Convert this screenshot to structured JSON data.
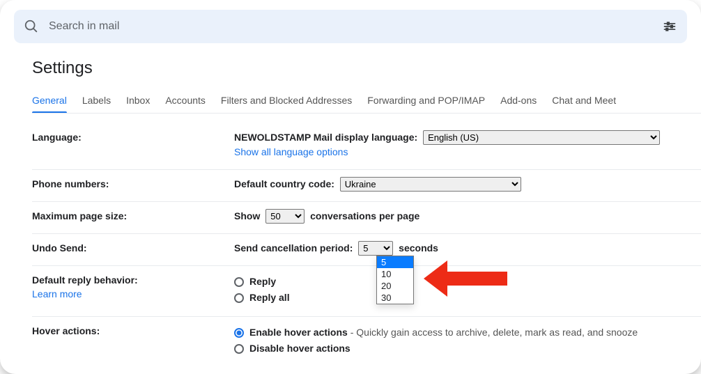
{
  "search": {
    "placeholder": "Search in mail"
  },
  "page_title": "Settings",
  "tabs": [
    "General",
    "Labels",
    "Inbox",
    "Accounts",
    "Filters and Blocked Addresses",
    "Forwarding and POP/IMAP",
    "Add-ons",
    "Chat and Meet"
  ],
  "language": {
    "label": "Language:",
    "display_language_label": "NEWOLDSTAMP Mail display language:",
    "selected": "English (US)",
    "show_all": "Show all language options"
  },
  "phone": {
    "label": "Phone numbers:",
    "default_country_label": "Default country code:",
    "selected": "Ukraine"
  },
  "page_size": {
    "label": "Maximum page size:",
    "show": "Show",
    "selected": "50",
    "suffix": "conversations per page"
  },
  "undo": {
    "label": "Undo Send:",
    "period_label": "Send cancellation period:",
    "selected": "5",
    "suffix": "seconds",
    "options": [
      "5",
      "10",
      "20",
      "30"
    ]
  },
  "default_reply": {
    "label": "Default reply behavior:",
    "learn_more": "Learn more",
    "reply": "Reply",
    "reply_all": "Reply all"
  },
  "hover": {
    "label": "Hover actions:",
    "enable": "Enable hover actions",
    "enable_desc": " - Quickly gain access to archive, delete, mark as read, and snooze",
    "disable": "Disable hover actions"
  }
}
